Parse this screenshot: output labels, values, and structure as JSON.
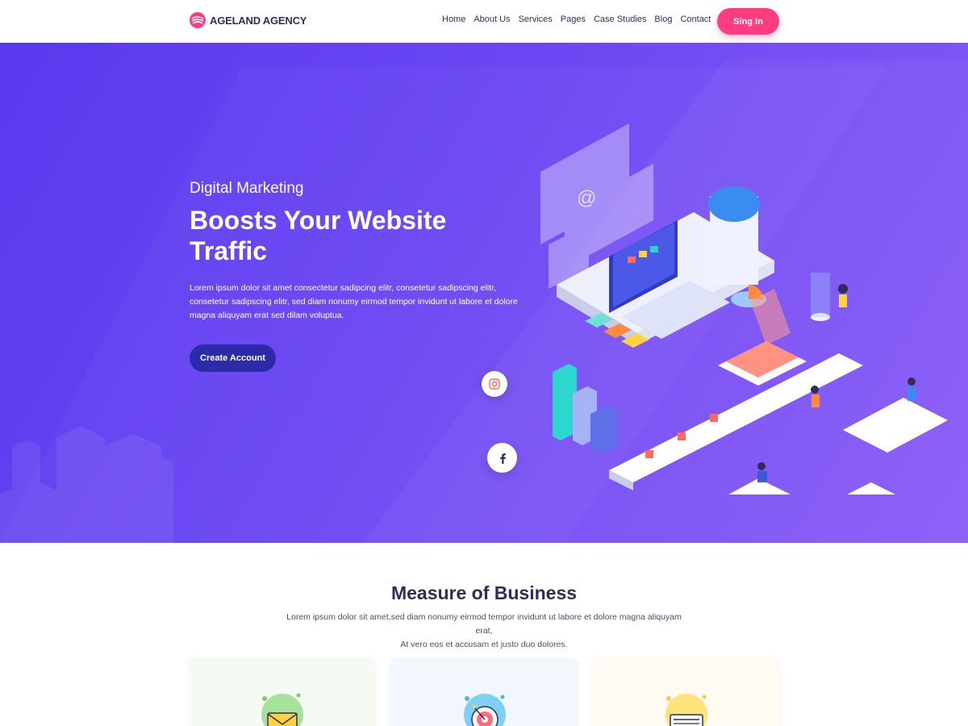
{
  "header": {
    "brand": "AGELAND AGENCY",
    "nav": [
      "Home",
      "About Us",
      "Services",
      "Pages",
      "Case Studies",
      "Blog",
      "Contact"
    ],
    "signin_label": "Sing In"
  },
  "hero": {
    "eyebrow": "Digital Marketing",
    "headline": "Boosts Your Website Traffic",
    "text": "Lorem ipsum dolor sit amet consectetur sadipcing elitr, consetetur sadipscing elitr, consetetur sadipscing elitr, sed diam nonumy eirmod tempor invidunt ut labore et dolore magna aliquyam erat sed dilam voluptua.",
    "cta_label": "Create Account",
    "socials": [
      "instagram-icon",
      "facebook-icon"
    ]
  },
  "section": {
    "title": "Measure of Business",
    "text_line1": "Lorem ipsum dolor sit amet,sed diam nonumy eirmod tempor invidunt ut labore et dolore magna aliquyam erat,",
    "text_line2": "At vero eos et accusam et justo duo dolores."
  },
  "colors": {
    "accent": "#ff3c7f",
    "hero_start": "#5a38ee",
    "hero_end": "#8b5cf7",
    "cta": "#2b2aa8",
    "heading": "#2d2f5a"
  },
  "cards": [
    {
      "icon": "mail-icon"
    },
    {
      "icon": "target-icon"
    },
    {
      "icon": "document-icon"
    }
  ]
}
